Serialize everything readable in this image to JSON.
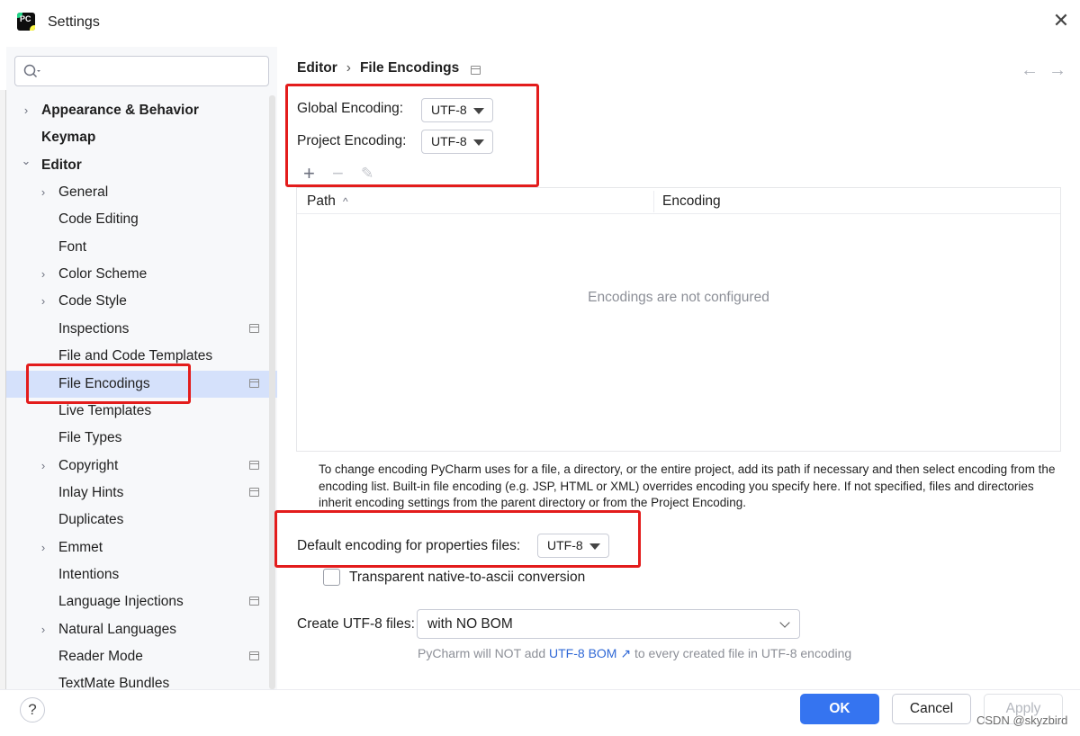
{
  "window": {
    "title": "Settings",
    "logo_text": "PC"
  },
  "sidebar": {
    "search_placeholder": "",
    "items": [
      {
        "label": "Appearance & Behavior",
        "bold": true,
        "expander": "collapsed",
        "indent": 0
      },
      {
        "label": "Keymap",
        "bold": true,
        "expander": "none",
        "indent": 0
      },
      {
        "label": "Editor",
        "bold": true,
        "expander": "expanded",
        "indent": 0
      },
      {
        "label": "General",
        "expander": "collapsed",
        "indent": 1
      },
      {
        "label": "Code Editing",
        "expander": "none",
        "indent": 1
      },
      {
        "label": "Font",
        "expander": "none",
        "indent": 1
      },
      {
        "label": "Color Scheme",
        "expander": "collapsed",
        "indent": 1
      },
      {
        "label": "Code Style",
        "expander": "collapsed",
        "indent": 1
      },
      {
        "label": "Inspections",
        "expander": "none",
        "indent": 1,
        "project_icon": true
      },
      {
        "label": "File and Code Templates",
        "expander": "none",
        "indent": 1
      },
      {
        "label": "File Encodings",
        "expander": "none",
        "indent": 1,
        "project_icon": true,
        "selected": true
      },
      {
        "label": "Live Templates",
        "expander": "none",
        "indent": 1
      },
      {
        "label": "File Types",
        "expander": "none",
        "indent": 1
      },
      {
        "label": "Copyright",
        "expander": "collapsed",
        "indent": 1,
        "project_icon": true
      },
      {
        "label": "Inlay Hints",
        "expander": "none",
        "indent": 1,
        "project_icon": true
      },
      {
        "label": "Duplicates",
        "expander": "none",
        "indent": 1
      },
      {
        "label": "Emmet",
        "expander": "collapsed",
        "indent": 1
      },
      {
        "label": "Intentions",
        "expander": "none",
        "indent": 1
      },
      {
        "label": "Language Injections",
        "expander": "none",
        "indent": 1,
        "project_icon": true
      },
      {
        "label": "Natural Languages",
        "expander": "collapsed",
        "indent": 1
      },
      {
        "label": "Reader Mode",
        "expander": "none",
        "indent": 1,
        "project_icon": true
      },
      {
        "label": "TextMate Bundles",
        "expander": "none",
        "indent": 1
      }
    ]
  },
  "breadcrumb": {
    "parent": "Editor",
    "separator": "›",
    "current": "File Encodings"
  },
  "nav": {
    "back": "←",
    "forward": "→"
  },
  "encodings": {
    "global_label": "Global Encoding:",
    "global_value": "UTF-8",
    "project_label": "Project Encoding:",
    "project_value": "UTF-8"
  },
  "toolbar": {
    "add": "+",
    "remove": "−",
    "edit": "✎"
  },
  "table": {
    "columns": [
      "Path",
      "Encoding"
    ],
    "sort_indicator": "^",
    "empty_text": "Encodings are not configured"
  },
  "help_text": "To change encoding PyCharm uses for a file, a directory, or the entire project, add its path if necessary and then select encoding from the encoding list. Built-in file encoding (e.g. JSP, HTML or XML) overrides encoding you specify here. If not specified, files and directories inherit encoding settings from the parent directory or from the Project Encoding.",
  "properties": {
    "label": "Default encoding for properties files:",
    "value": "UTF-8",
    "transparent_label": "Transparent native-to-ascii conversion",
    "transparent_checked": false
  },
  "bom": {
    "label": "Create UTF-8 files:",
    "value": "with NO BOM",
    "hint_prefix": "PyCharm will NOT add",
    "hint_link": "UTF-8 BOM ↗",
    "hint_suffix": "to every created file in UTF-8 encoding"
  },
  "buttons": {
    "help": "?",
    "ok": "OK",
    "cancel": "Cancel",
    "apply": "Apply"
  },
  "watermark": "CSDN @skyzbird",
  "colors": {
    "accent": "#3574f0",
    "selection": "#d5e1fb",
    "annotation": "#e31c1c"
  }
}
